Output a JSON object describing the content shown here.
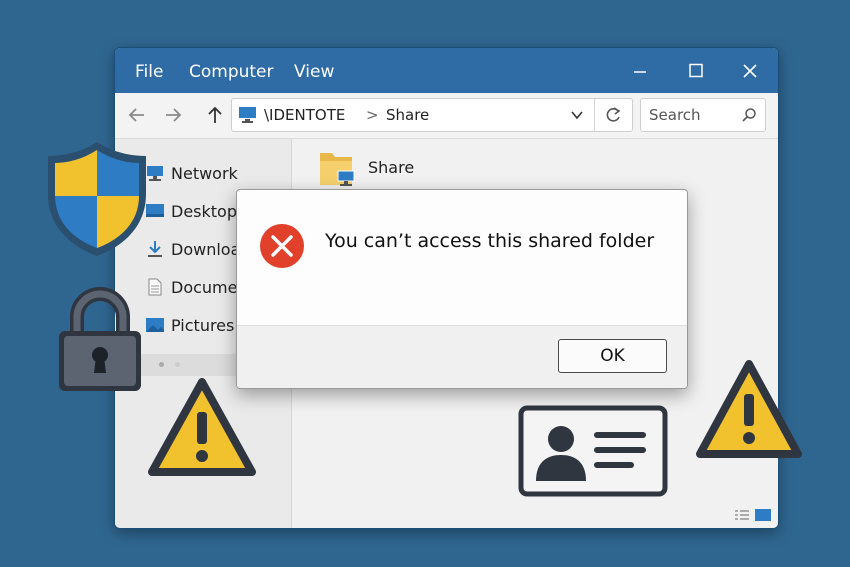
{
  "menu": {
    "items": [
      "File",
      "Computer",
      "View"
    ]
  },
  "window_controls": {
    "minimize_icon": "minimize-icon",
    "maximize_icon": "maximize-icon",
    "close_icon": "close-icon"
  },
  "address_bar": {
    "computer": "\\IDENTOTE",
    "folder": "Share",
    "separator": ">"
  },
  "search": {
    "placeholder": "Search"
  },
  "sidebar": {
    "items": [
      {
        "label": "Network",
        "icon": "network-icon"
      },
      {
        "label": "Desktop",
        "icon": "desktop-icon"
      },
      {
        "label": "Downloads",
        "icon": "download-icon"
      },
      {
        "label": "Documents",
        "icon": "document-icon"
      },
      {
        "label": "Pictures",
        "icon": "pictures-icon"
      }
    ]
  },
  "content": {
    "folder_name": "Share"
  },
  "dialog": {
    "message": "You can’t access this shared folder",
    "ok_label": "OK",
    "icon": "error-icon"
  },
  "colors": {
    "background": "#2f6690",
    "titlebar": "#2f6ba4",
    "error_red": "#e1402a",
    "warning_yellow": "#f2c12e",
    "shield_blue": "#2e7cc4"
  }
}
